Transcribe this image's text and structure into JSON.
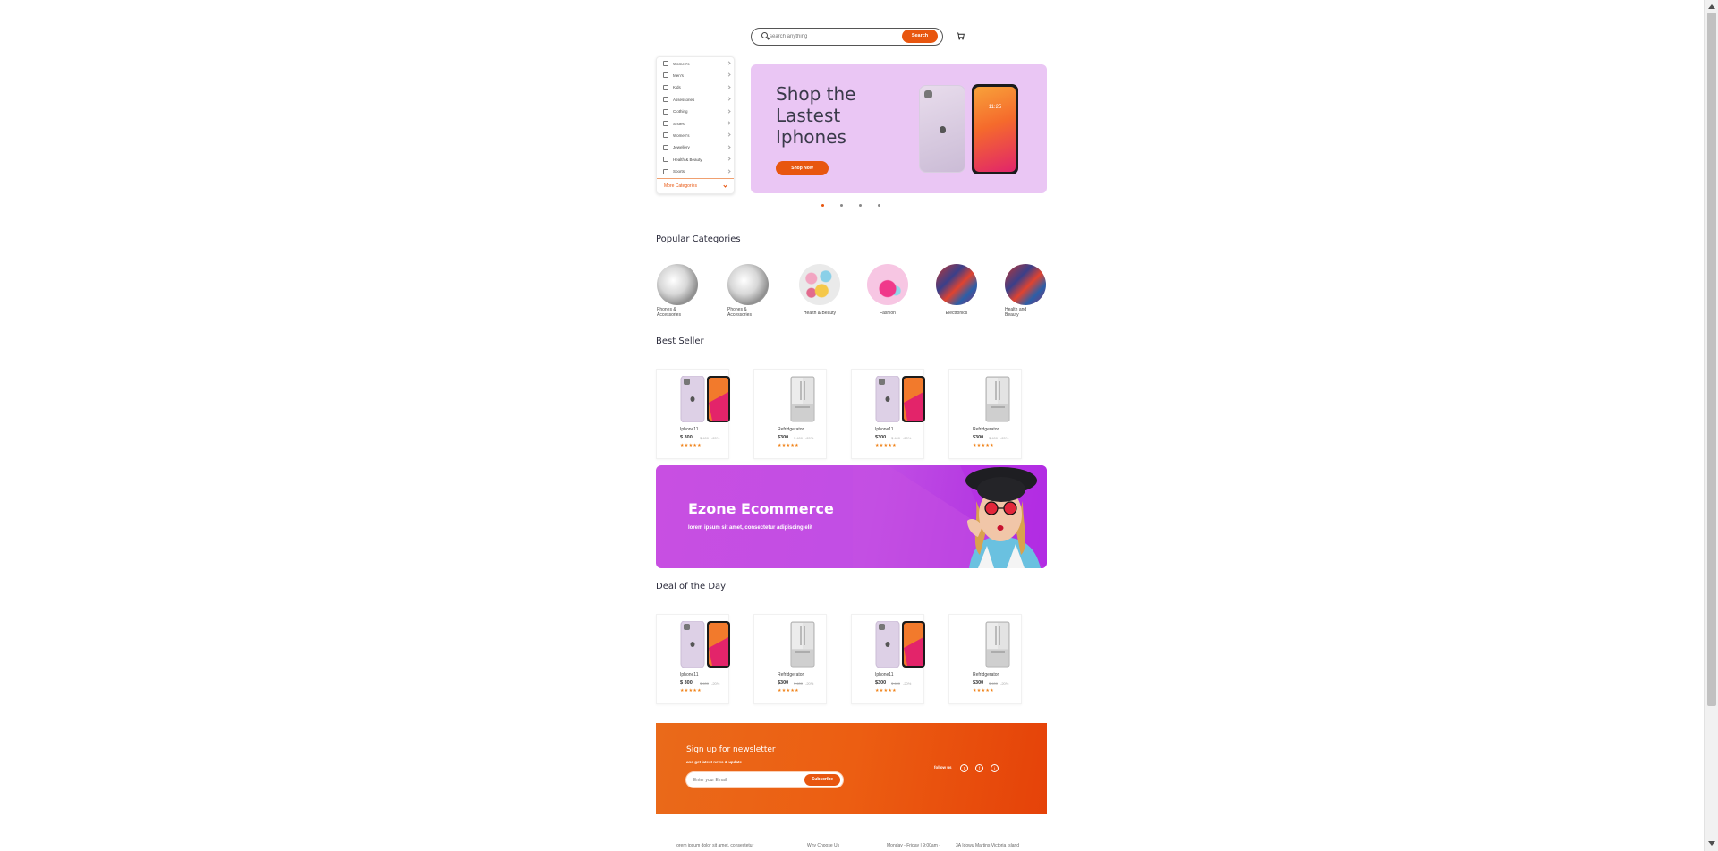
{
  "header": {
    "search_placeholder": "search anything",
    "search_button": "Search",
    "cart_icon": "shopping-cart-icon"
  },
  "categories": {
    "items": [
      {
        "label": "Women's",
        "icon": "dress-icon"
      },
      {
        "label": "Men's",
        "icon": "shirt-icon"
      },
      {
        "label": "Kids",
        "icon": "kids-icon"
      },
      {
        "label": "Assessories",
        "icon": "glasses-icon"
      },
      {
        "label": "Clothing",
        "icon": "hanger-icon"
      },
      {
        "label": "Shoes",
        "icon": "shoe-icon"
      },
      {
        "label": "Women's",
        "icon": "location-icon"
      },
      {
        "label": "Jewellery",
        "icon": "ring-icon"
      },
      {
        "label": "Health & Beauty",
        "icon": "beauty-icon"
      },
      {
        "label": "Sports",
        "icon": "ball-icon"
      }
    ],
    "more_label": "More Categories"
  },
  "hero": {
    "title": "Shop the Lastest Iphones",
    "button": "Shop Now",
    "phone_time": "11:25",
    "slides": 4,
    "active_slide": 1
  },
  "popular": {
    "title": "Popular Categories",
    "items": [
      {
        "label": "Phones & Accessories"
      },
      {
        "label": "Phones & Accessories"
      },
      {
        "label": "Health & Beauty"
      },
      {
        "label": "Fashion"
      },
      {
        "label": "Electronics"
      },
      {
        "label": "Health and Beauty"
      }
    ]
  },
  "best_seller": {
    "title": "Best Seller",
    "products": [
      {
        "name": "Iphone11",
        "price": "$ 300",
        "old_price": "$ 400",
        "discount": "-20%",
        "rating": "★★★★★",
        "kind": "phone"
      },
      {
        "name": "Refridgerator",
        "price": "$300",
        "old_price": "$ 400",
        "discount": "-20%",
        "rating": "★★★★★",
        "kind": "fridge"
      },
      {
        "name": "Iphone11",
        "price": "$300",
        "old_price": "$ 400",
        "discount": "-20%",
        "rating": "★★★★★",
        "kind": "phone"
      },
      {
        "name": "Refridgerator",
        "price": "$300",
        "old_price": "$ 400",
        "discount": "-20%",
        "rating": "★★★★★",
        "kind": "fridge"
      }
    ]
  },
  "promo": {
    "title": "Ezone Ecommerce",
    "subtitle": "lorem ipsum sit amet, consectetur adipiscing elit"
  },
  "deal": {
    "title": "Deal of the Day",
    "products": [
      {
        "name": "Iphone11",
        "price": "$ 300",
        "old_price": "$ 400",
        "discount": "-20%",
        "rating": "★★★★★",
        "kind": "phone"
      },
      {
        "name": "Refridgerator",
        "price": "$300",
        "old_price": "$ 400",
        "discount": "-20%",
        "rating": "★★★★★",
        "kind": "fridge"
      },
      {
        "name": "Iphone11",
        "price": "$300",
        "old_price": "$ 400",
        "discount": "-20%",
        "rating": "★★★★★",
        "kind": "phone"
      },
      {
        "name": "Refridgerator",
        "price": "$300",
        "old_price": "$ 400",
        "discount": "-20%",
        "rating": "★★★★★",
        "kind": "fridge"
      }
    ]
  },
  "newsletter": {
    "title": "Sign up for newsletter",
    "subtitle": "and get latest news & update",
    "placeholder": "Enter your Email",
    "button": "Subscribe",
    "follow_label": "follow us",
    "social": [
      {
        "icon": "twitter-icon",
        "glyph": "t"
      },
      {
        "icon": "facebook-icon",
        "glyph": "f"
      },
      {
        "icon": "instagram-icon",
        "glyph": "i"
      }
    ]
  },
  "footer": {
    "about": "lorem ipsum dolor sit amet, consectetur",
    "why": "Why Choose Us",
    "hours": "Monday - Friday | 9:00am -",
    "address": "3A Idowu Martins Victoria Island"
  },
  "colors": {
    "accent": "#e8560f",
    "hero_bg": "#eac6f4",
    "promo_bg": "#c84fe2",
    "star": "#f08218"
  }
}
